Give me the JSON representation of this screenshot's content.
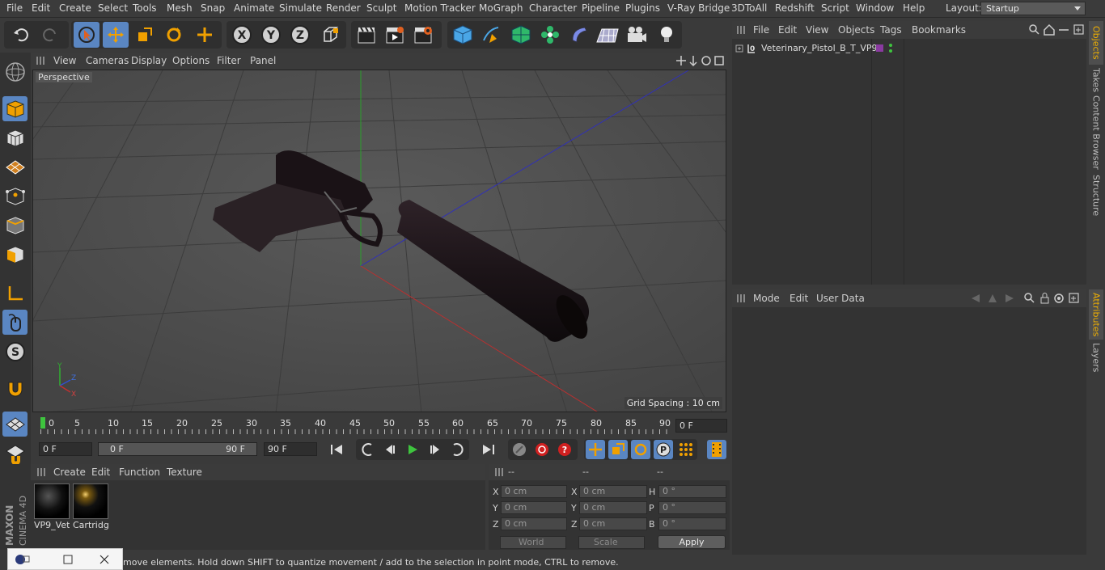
{
  "menubar": {
    "items": [
      "File",
      "Edit",
      "Create",
      "Select",
      "Tools",
      "Mesh",
      "Snap",
      "Animate",
      "Simulate",
      "Render",
      "Sculpt",
      "Motion Tracker",
      "MoGraph",
      "Character",
      "Pipeline",
      "Plugins",
      "V-Ray Bridge",
      "3DToAll",
      "Redshift",
      "Script",
      "Window",
      "Help"
    ],
    "layout_label": "Layout:",
    "layout_value": "Startup"
  },
  "viewport": {
    "menu": [
      "View",
      "Cameras",
      "Display",
      "Options",
      "Filter",
      "Panel"
    ],
    "label": "Perspective",
    "grid_spacing": "Grid Spacing : 10 cm",
    "axis_labels": {
      "x": "X",
      "y": "Y",
      "z": "Z"
    }
  },
  "timeline": {
    "ticks": [
      "0",
      "5",
      "10",
      "15",
      "20",
      "25",
      "30",
      "35",
      "40",
      "45",
      "50",
      "55",
      "60",
      "65",
      "70",
      "75",
      "80",
      "85",
      "90"
    ],
    "current_frame": "0 F",
    "start_field": "0 F",
    "range_start": "0 F",
    "range_end": "90 F",
    "end_field": "90 F"
  },
  "materials": {
    "menu": [
      "Create",
      "Edit",
      "Function",
      "Texture"
    ],
    "items": [
      {
        "name": "VP9_Vet"
      },
      {
        "name": "Cartridg"
      }
    ]
  },
  "coordinates": {
    "headers": [
      "--",
      "--",
      "--"
    ],
    "rows": [
      {
        "l1": "X",
        "v1": "0 cm",
        "l2": "X",
        "v2": "0 cm",
        "l3": "H",
        "v3": "0 °"
      },
      {
        "l1": "Y",
        "v1": "0 cm",
        "l2": "Y",
        "v2": "0 cm",
        "l3": "P",
        "v3": "0 °"
      },
      {
        "l1": "Z",
        "v1": "0 cm",
        "l2": "Z",
        "v2": "0 cm",
        "l3": "B",
        "v3": "0 °"
      }
    ],
    "mode_world": "World",
    "mode_scale": "Scale",
    "apply": "Apply"
  },
  "object_manager": {
    "menu": [
      "File",
      "Edit",
      "View",
      "Objects",
      "Tags",
      "Bookmarks"
    ],
    "objects": [
      {
        "name": "Veterinary_Pistol_B_T_VP9"
      }
    ]
  },
  "attribute_manager": {
    "menu": [
      "Mode",
      "Edit",
      "User Data"
    ]
  },
  "side_tabs": [
    "Objects",
    "Takes",
    "Content Browser",
    "Structure"
  ],
  "side_tabs_lower": [
    "Attributes",
    "Layers"
  ],
  "branding": {
    "maxon": "MAXON",
    "product": "CINEMA 4D"
  },
  "status": "move elements. Hold down SHIFT to quantize movement / add to the selection in point mode, CTRL to remove.",
  "colors": {
    "accent": "#5a86c2",
    "active_tab": "#f0b000",
    "axis_x": "#c03030",
    "axis_y": "#30b030",
    "axis_z": "#3030c0"
  }
}
